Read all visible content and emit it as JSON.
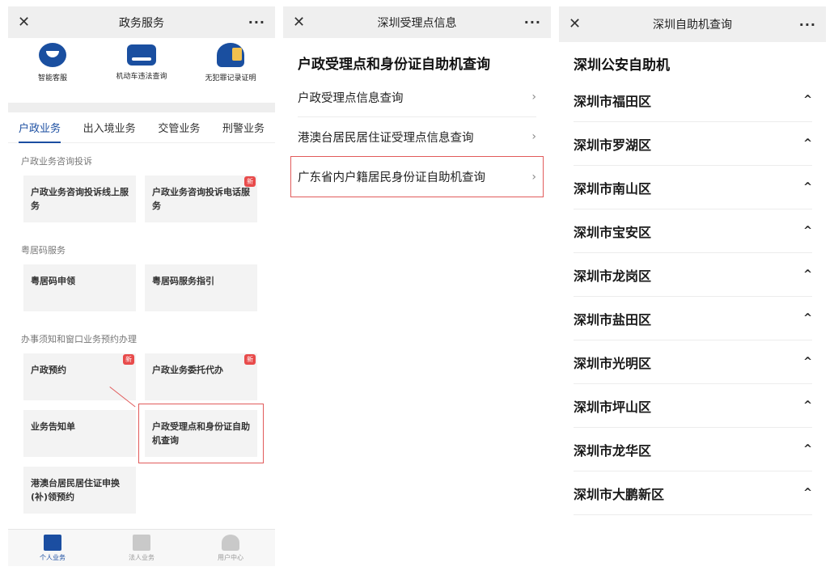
{
  "panel1": {
    "title": "政务服务",
    "close": "✕",
    "more": "···",
    "quick": [
      {
        "label": "智能客服"
      },
      {
        "label": "机动车违法查询"
      },
      {
        "label": "无犯罪记录证明"
      }
    ],
    "tabs": [
      "户政业务",
      "出入境业务",
      "交管业务",
      "刑警业务"
    ],
    "sections": [
      {
        "label": "户政业务咨询投诉",
        "cards": [
          {
            "text": "户政业务咨询投诉线上服务",
            "badge": ""
          },
          {
            "text": "户政业务咨询投诉电话服务",
            "badge": "新"
          }
        ]
      },
      {
        "label": "粤居码服务",
        "cards": [
          {
            "text": "粤居码申领",
            "badge": ""
          },
          {
            "text": "粤居码服务指引",
            "badge": ""
          }
        ]
      },
      {
        "label": "办事须知和窗口业务预约办理",
        "cards": [
          {
            "text": "户政预约",
            "badge": "新"
          },
          {
            "text": "户政业务委托代办",
            "badge": "新"
          },
          {
            "text": "业务告知单",
            "badge": ""
          },
          {
            "text": "户政受理点和身份证自助机查询",
            "badge": ""
          },
          {
            "text": "港澳台居民居住证申换(补)领预约",
            "badge": ""
          }
        ]
      }
    ],
    "nav": [
      {
        "label": "个人业务"
      },
      {
        "label": "法人业务"
      },
      {
        "label": "用户中心"
      }
    ]
  },
  "panel2": {
    "title": "深圳受理点信息",
    "close": "✕",
    "more": "···",
    "heading": "户政受理点和身份证自助机查询",
    "items": [
      {
        "label": "户政受理点信息查询"
      },
      {
        "label": "港澳台居民居住证受理点信息查询"
      },
      {
        "label": "广东省内户籍居民身份证自助机查询"
      }
    ],
    "chevron": "›"
  },
  "panel3": {
    "title": "深圳自助机查询",
    "close": "✕",
    "more": "···",
    "heading": "深圳公安自助机",
    "districts": [
      "深圳市福田区",
      "深圳市罗湖区",
      "深圳市南山区",
      "深圳市宝安区",
      "深圳市龙岗区",
      "深圳市盐田区",
      "深圳市光明区",
      "深圳市坪山区",
      "深圳市龙华区",
      "深圳市大鹏新区"
    ],
    "up": "^"
  }
}
